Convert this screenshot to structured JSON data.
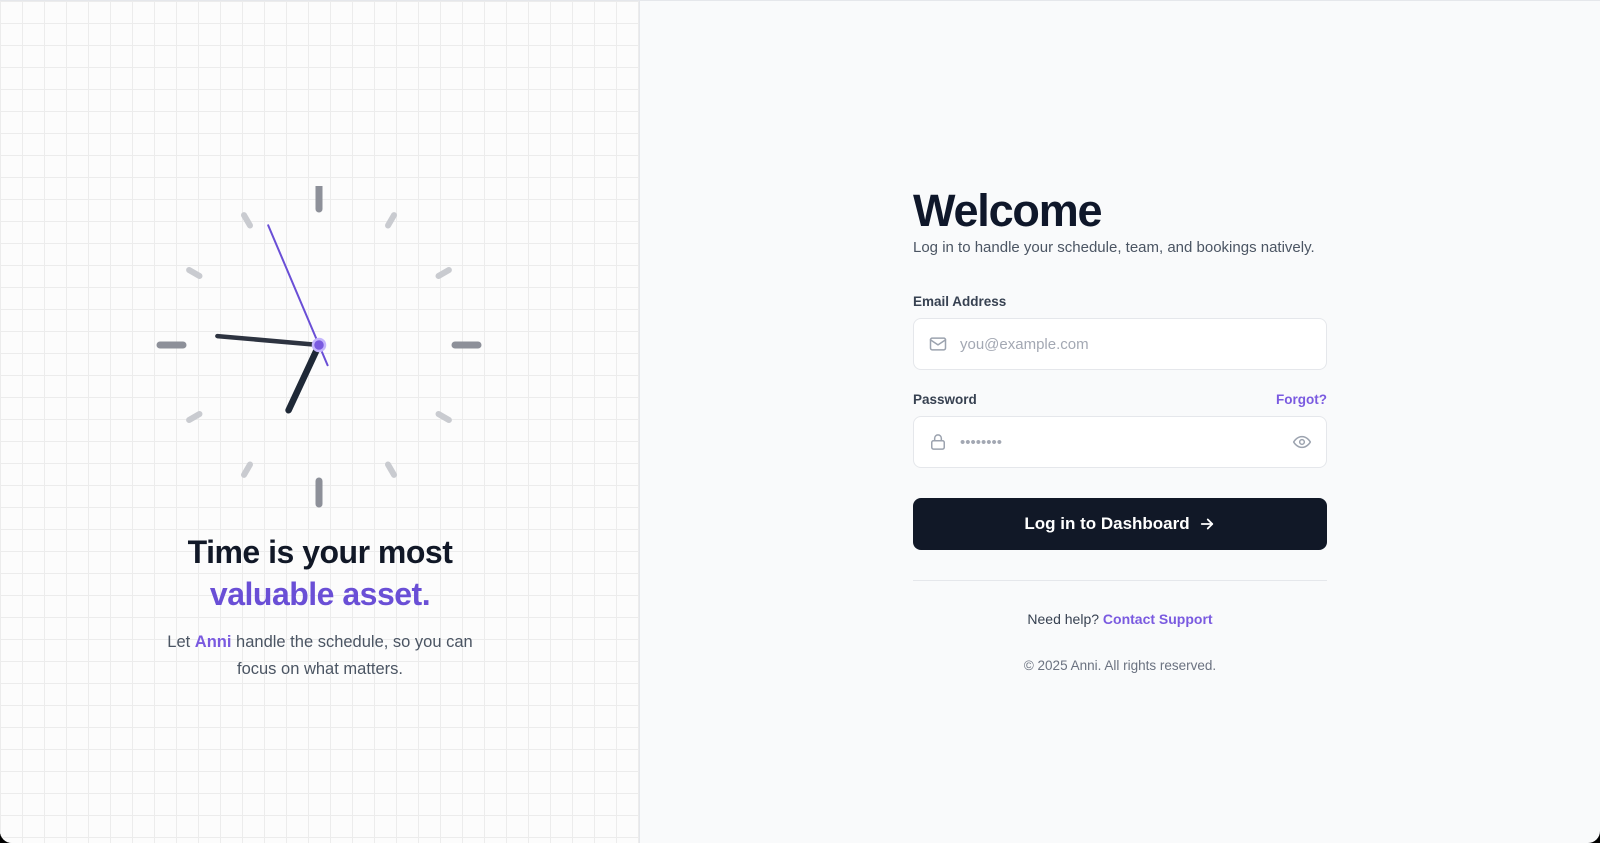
{
  "hero": {
    "headline_line1": "Time is your most",
    "headline_line2": "valuable asset.",
    "tagline_prefix": "Let ",
    "brand": "Anni",
    "tagline_suffix": " handle the schedule, so you can focus on what matters."
  },
  "clock": {
    "hour_hand_angle_deg": 205,
    "minute_hand_angle_deg": 275,
    "second_hand_angle_deg": 337,
    "colors": {
      "ticks_major": "#8d9099",
      "ticks_minor": "#c9cbd0",
      "hands": "#1f2937",
      "second_hand": "#6a4fd6"
    }
  },
  "login": {
    "title": "Welcome",
    "subtitle": "Log in to handle your schedule, team, and bookings natively.",
    "email_label": "Email Address",
    "email_placeholder": "you@example.com",
    "email_value": "",
    "password_label": "Password",
    "forgot_label": "Forgot?",
    "password_placeholder": "••••••••",
    "password_value": "",
    "submit_label": "Log in to Dashboard",
    "help_text": "Need help?",
    "support_link": "Contact Support",
    "copyright": "© 2025 Anni. All rights reserved."
  },
  "colors": {
    "accent": "#6a4fd6",
    "primary_button": "#111827",
    "background": "#f9fafb"
  },
  "icons": {
    "email": "mail-icon",
    "password": "lock-icon",
    "toggle": "eye-icon",
    "submit": "arrow-right-icon"
  }
}
